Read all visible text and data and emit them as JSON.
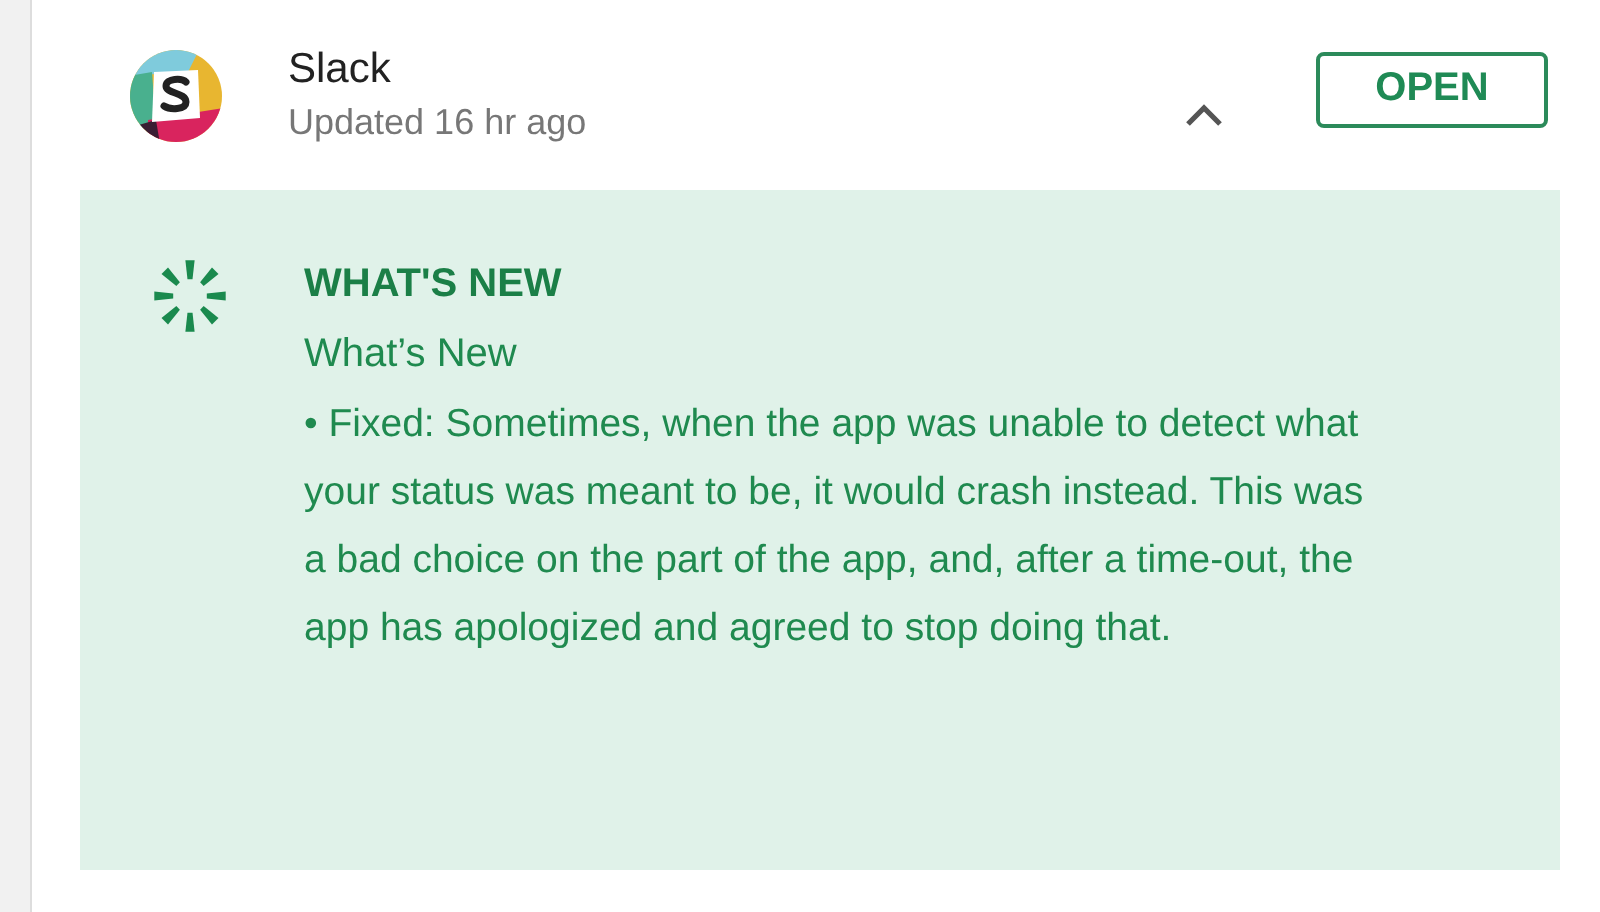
{
  "app": {
    "name": "Slack",
    "updated": "Updated 16 hr ago",
    "expanded": true,
    "open_button": "OPEN"
  },
  "whats_new": {
    "title": "WHAT'S NEW",
    "heading": "What’s New",
    "body": "• Fixed: Sometimes, when the app was unable to detect what your status was meant to be, it would crash instead. This was a bad choice on the part of the app, and, after a time-out, the app has apologized and agreed to stop doing that."
  }
}
